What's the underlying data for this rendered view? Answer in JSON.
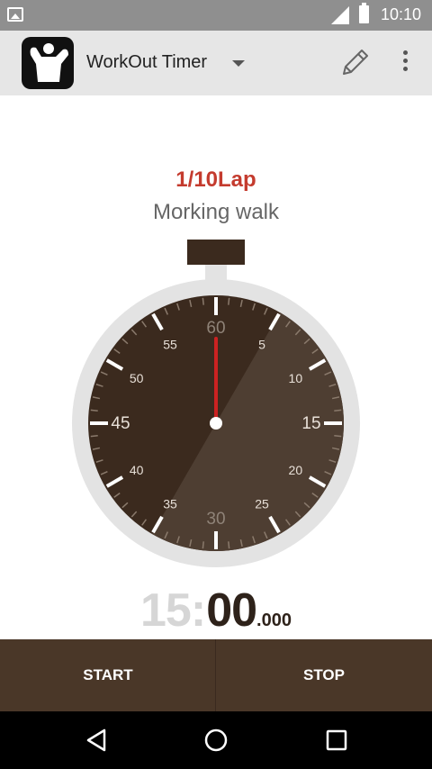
{
  "status_bar": {
    "time": "10:10"
  },
  "app_bar": {
    "title": "WorkOut Timer"
  },
  "workout": {
    "lap": "1/10Lap",
    "exercise": "Morking walk"
  },
  "stopwatch": {
    "dial_labels": [
      "60",
      "5",
      "10",
      "15",
      "20",
      "25",
      "30",
      "35",
      "40",
      "45",
      "50",
      "55"
    ],
    "elapsed_fraction": 0.5,
    "colors": {
      "face": "#3b2a1e",
      "elapsed": "#4e3e32",
      "rim": "#e3e3e3",
      "hand": "#cc2222"
    }
  },
  "time": {
    "minutes": "15",
    "colon": ":",
    "seconds": "00",
    "millis": ".000"
  },
  "controls": {
    "start_label": "START",
    "stop_label": "STOP"
  }
}
